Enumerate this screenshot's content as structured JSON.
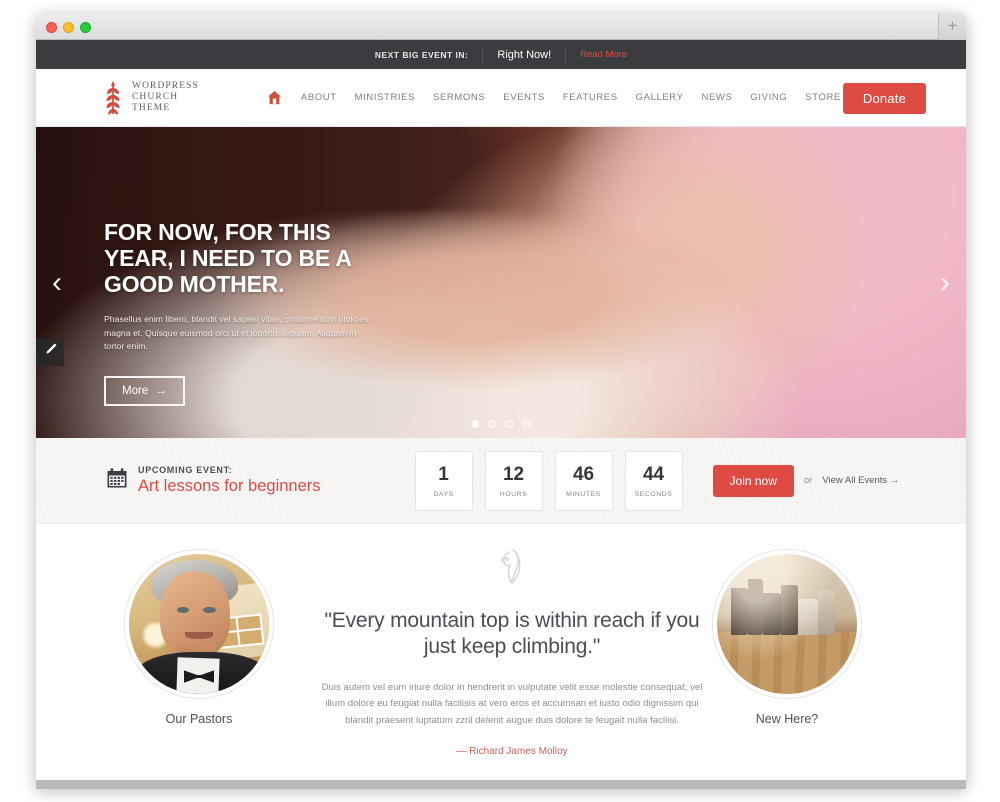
{
  "browser": {
    "traffic_lights": [
      "close",
      "minimize",
      "maximize"
    ],
    "new_tab_label": "+"
  },
  "topbar": {
    "label": "NEXT BIG EVENT IN:",
    "time": "Right Now!",
    "more_link": "Read More"
  },
  "header": {
    "logo": {
      "icon": "wheat-icon",
      "line1": "WORDPRESS",
      "line2": "CHURCH",
      "line3": "THEME"
    },
    "home_icon": "home-icon",
    "nav": [
      {
        "label": "ABOUT"
      },
      {
        "label": "MINISTRIES"
      },
      {
        "label": "SERMONS"
      },
      {
        "label": "EVENTS"
      },
      {
        "label": "FEATURES"
      },
      {
        "label": "GALLERY"
      },
      {
        "label": "NEWS"
      },
      {
        "label": "GIVING"
      },
      {
        "label": "STORE"
      }
    ],
    "search_icon": "search-icon",
    "donate_label": "Donate",
    "accent_color": "#dd4b43"
  },
  "hero": {
    "edit_icon": "pencil-icon",
    "prev_icon": "chevron-left-icon",
    "next_icon": "chevron-right-icon",
    "title": "FOR NOW, FOR THIS YEAR, I NEED TO BE A GOOD MOTHER.",
    "description": "Phasellus enim libero, blandit vel sapien vitae, condimentum ultricies magna et. Quisque euismod orci ut et lobortis aliquam. Aliquam in tortor enim.",
    "more_label": "More",
    "more_arrow": "→",
    "slide_count": 4,
    "active_slide": 1
  },
  "event": {
    "calendar_icon": "calendar-icon",
    "kicker": "UPCOMING EVENT:",
    "title": "Art lessons for beginners",
    "counters": [
      {
        "value": "1",
        "label": "DAYS"
      },
      {
        "value": "12",
        "label": "HOURS"
      },
      {
        "value": "46",
        "label": "MINUTES"
      },
      {
        "value": "44",
        "label": "SECONDS"
      }
    ],
    "join_label": "Join now",
    "or_label": "or",
    "view_all_label": "View All Events →"
  },
  "callouts": {
    "left_card": {
      "image": "pastor-portrait",
      "caption": "Our Pastors"
    },
    "right_card": {
      "image": "books-photo",
      "caption": "New Here?"
    },
    "quote": {
      "icon": "dove-icon",
      "text": "\"Every mountain top is within reach if you just keep climbing.\"",
      "body": "Duis autem vel eum iriure dolor in hendrerit in vulputate velit esse molestie consequat, vel illum dolore eu feugiat nulla facilisis at vero eros et accumsan et iusto odio dignissim qui blandit praesent luptatum zzril delenit augue duis dolore te feugait nulla facilisi.",
      "author": "— Richard James Molloy"
    }
  }
}
